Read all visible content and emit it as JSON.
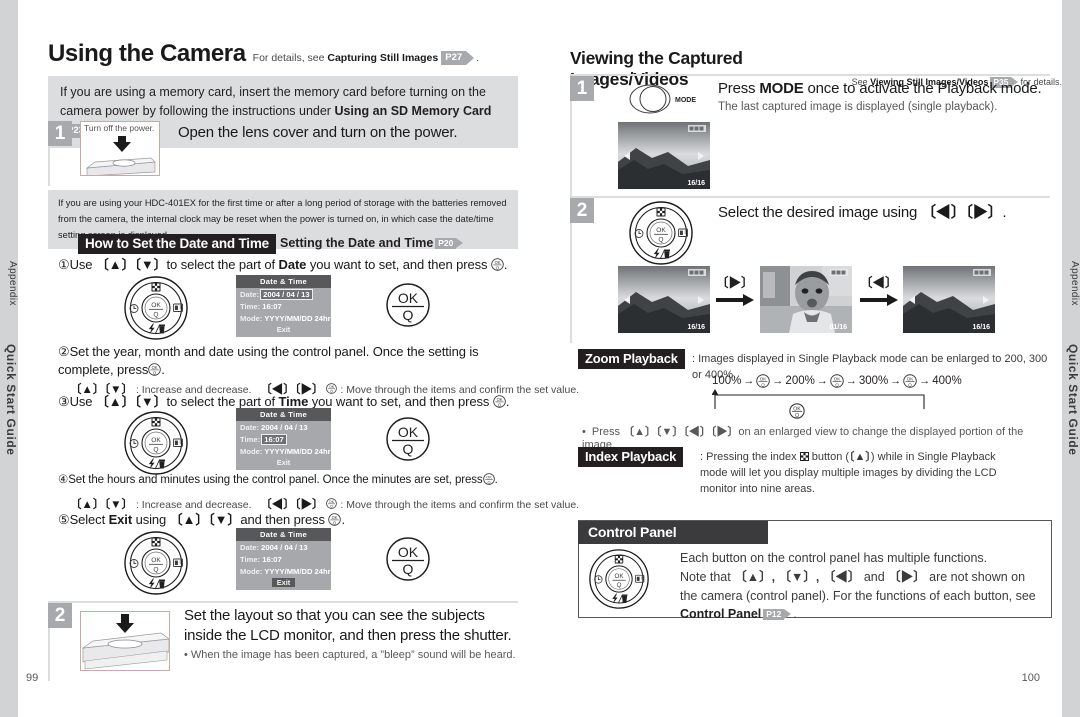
{
  "side_tabs": {
    "appendix": "Appendix",
    "quick_start_guide": "Quick Start Guide"
  },
  "left_page": {
    "page_number": "99",
    "title": "Using the Camera",
    "title_sub_pre": "For details, see ",
    "title_sub_bold": "Capturing Still Images",
    "title_ref": "P27",
    "title_sub_post": ".",
    "note_top_pre": "If you are using a memory card, insert the memory card before turning on the camera power by following the instructions under ",
    "note_top_bold": "Using an SD Memory Card",
    "note_top_ref": "P23",
    "note_top_post": ".",
    "step1": {
      "badge": "1",
      "illustration_caption": "Turn off the power.",
      "heading": "Open the lens cover and turn on the power."
    },
    "note_mid": "If you are using your HDC-401EX for the first time or after a long period of storage with the batteries removed from the camera, the internal clock may be reset when the power is turned on, in which case the date/time setting screen is displayed.",
    "section_label": "How to Set the Date and Time",
    "section_ref_text": "Setting the Date and Time",
    "section_ref": "P20",
    "substeps": [
      {
        "num": "①",
        "text_pre": "Use ",
        "keys": "〔▲〕〔▼〕",
        "text_mid": "to select the part of ",
        "bold": "Date",
        "text_post": " you want to set, and then press",
        "end": "."
      },
      {
        "num": "②",
        "text": "Set the year, month and date using the control panel. Once the setting is complete, press",
        "end": "."
      },
      {
        "num": "③",
        "text_pre": "Use ",
        "keys": "〔▲〕〔▼〕",
        "text_mid": "to select the part of ",
        "bold": "Time",
        "text_post": " you want to set, and then press ",
        "end": "."
      },
      {
        "num": "④",
        "text": "Set the hours and minutes using the control panel. Once the minutes are set, press",
        "end": "."
      },
      {
        "num": "⑤",
        "text_pre": "Select ",
        "bold": "Exit",
        "text_mid": " using ",
        "keys": "〔▲〕〔▼〕",
        "text_post": "and then press ",
        "end": "."
      }
    ],
    "key_hint": {
      "ud_keys": "〔▲〕〔▼〕",
      "ud_text": ": Increase and decrease.",
      "lr_keys": "〔◀〕〔▶〕",
      "lr_text": ": Move through the items and confirm the set value."
    },
    "lcd_panels": [
      {
        "title": "Date & Time",
        "date_label": "Date:",
        "date_value": "2004 / 04 / 13",
        "time_label": "Time:",
        "time_value": "16:07",
        "mode_label": "Mode:",
        "mode_value": "YYYY/MM/DD 24hr",
        "exit": "Exit",
        "highlight": "date"
      },
      {
        "title": "Date & Time",
        "date_label": "Date:",
        "date_value": "2004 / 04 / 13",
        "time_label": "Time:",
        "time_value": "16:07",
        "mode_label": "Mode:",
        "mode_value": "YYYY/MM/DD 24hr",
        "exit": "Exit",
        "highlight": "time"
      },
      {
        "title": "Date & Time",
        "date_label": "Date:",
        "date_value": "2004 / 04 / 13",
        "time_label": "Time:",
        "time_value": "16:07",
        "mode_label": "Mode:",
        "mode_value": "YYYY/MM/DD 24hr",
        "exit": "Exit",
        "highlight": "exit"
      }
    ],
    "ok_button": {
      "ok": "OK",
      "q": "Q"
    },
    "step2": {
      "badge": "2",
      "heading": "Set the layout so that you can see the subjects inside the LCD monitor, and then press the shutter.",
      "bullet": "When the image has been captured, a ”bleep” sound will be heard."
    }
  },
  "right_page": {
    "page_number": "100",
    "title": "Viewing the Captured Images/Videos",
    "title_sub_pre": "See ",
    "title_sub_bold": "Viewing Still Images/Videos",
    "title_ref": "P35",
    "title_sub_post": "for details.",
    "step1": {
      "badge": "1",
      "mode_button_label": "MODE",
      "heading_pre": "Press ",
      "heading_bold": "MODE",
      "heading_post": " once to activate the Playback mode.",
      "sub": "The last captured image is displayed (single playback).",
      "thumb_counter": "16/16"
    },
    "step2": {
      "badge": "2",
      "heading_pre": "Select the desired image using ",
      "heading_keys": "〔◀〕〔▶〕",
      "heading_post": ".",
      "flow": [
        {
          "counter": "16/16",
          "scene": "landscape"
        },
        {
          "key": "〔▶〕"
        },
        {
          "counter": "01/16",
          "scene": "baby"
        },
        {
          "key": "〔◀〕"
        },
        {
          "counter": "16/16",
          "scene": "landscape"
        }
      ]
    },
    "zoom_playback": {
      "label": "Zoom Playback",
      "text": ": Images displayed in Single Playback mode can be enlarged to 200, 300 or 400%.",
      "chain": [
        "100%",
        "200%",
        "300%",
        "400%"
      ],
      "bullet_pre": "Press ",
      "bullet_keys": "〔▲〕〔▼〕〔◀〕〔▶〕",
      "bullet_post": "on an enlarged view to change the displayed portion of the image."
    },
    "index_playback": {
      "label": "Index Playback",
      "text_pre": ": Pressing the index ",
      "text_mid": " button (",
      "text_key": "〔▲〕",
      "text_post": ") while in Single Playback mode will let you display multiple images by dividing the LCD monitor into nine areas."
    },
    "control_panel": {
      "header": "Control Panel",
      "line1": "Each button on the control panel has multiple functions.",
      "line2_pre": "Note that ",
      "line2_keys": "〔▲〕, 〔▼〕, 〔◀〕",
      "line2_mid": " and ",
      "line2_keys2": "〔▶〕",
      "line2_post": " are not shown on the camera (control panel). For the functions of each button, see ",
      "bold1": "Control Panel",
      "ref": "P12",
      "line3_post": "."
    }
  },
  "colors": {
    "grey_box": "#dcdddf",
    "badge_grey": "#a7a9ac",
    "dark_bar": "#231f20",
    "tab_grey": "#d2d3d5",
    "lcd_grey": "#a6a8ab"
  }
}
